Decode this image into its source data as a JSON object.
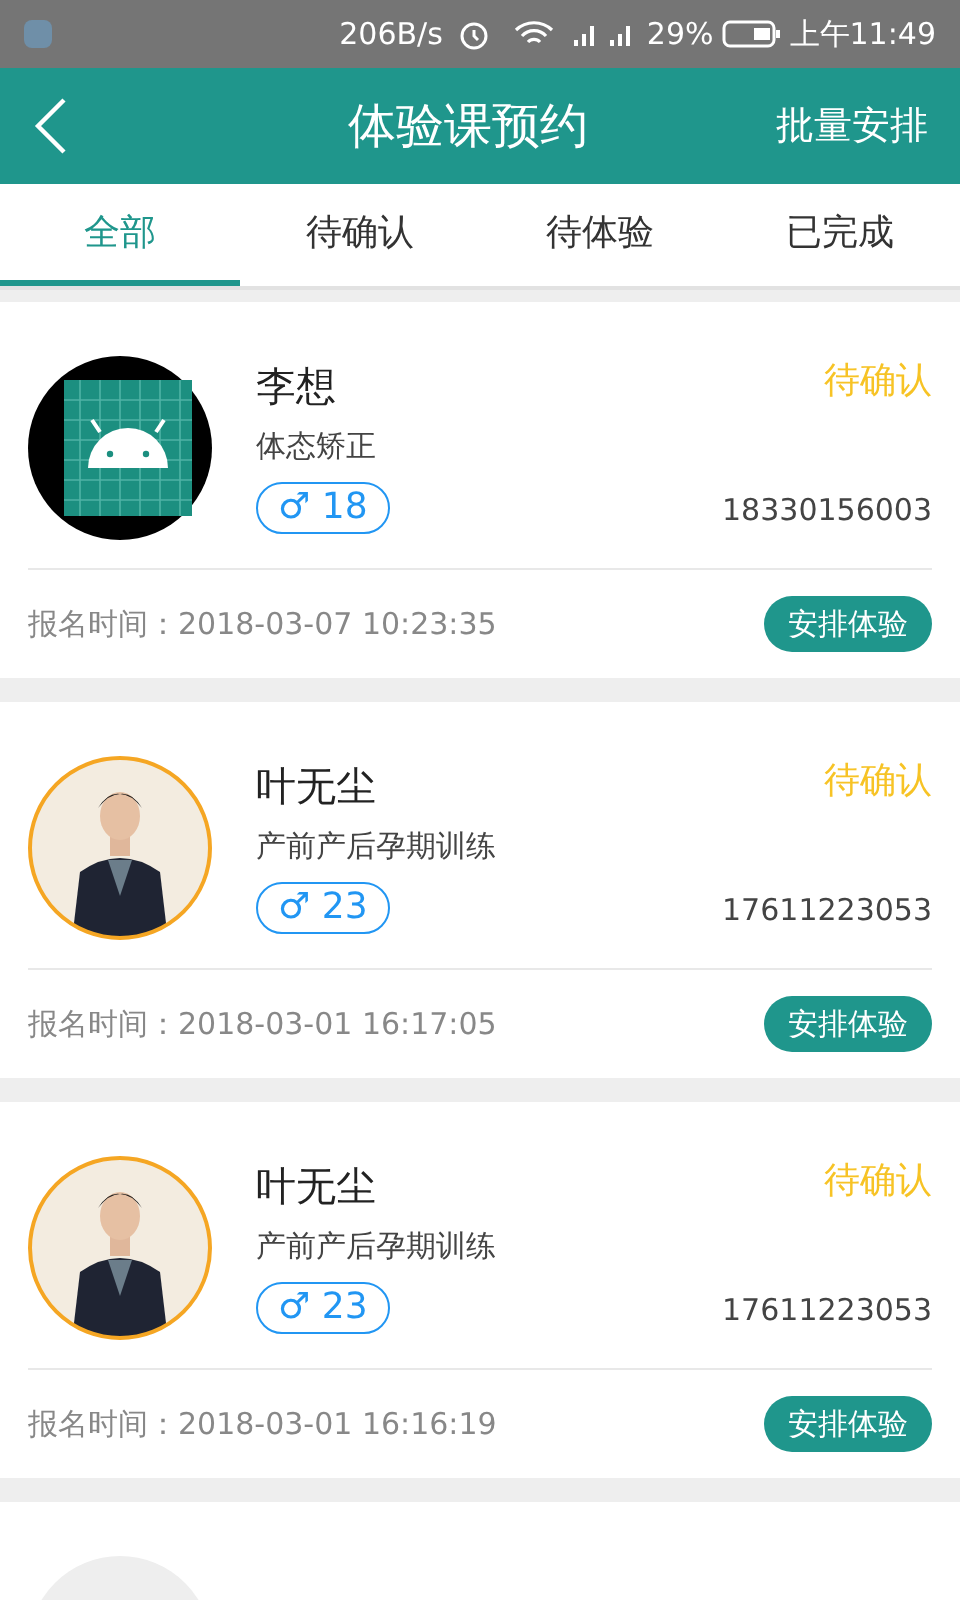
{
  "status_bar": {
    "speed": "206B/s",
    "battery": "29%",
    "time": "上午11:49"
  },
  "header": {
    "title": "体验课预约",
    "action": "批量安排"
  },
  "tabs": [
    {
      "label": "全部",
      "selected": true
    },
    {
      "label": "待确认",
      "selected": false
    },
    {
      "label": "待体验",
      "selected": false
    },
    {
      "label": "已完成",
      "selected": false
    }
  ],
  "cards": [
    {
      "kind": "android",
      "name": "李想",
      "status": "待确认",
      "course": "体态矫正",
      "gender_symbol": "♂",
      "age": "18",
      "phone": "18330156003",
      "time_label": "报名时间：",
      "time": "2018-03-07 10:23:35",
      "button": "安排体验"
    },
    {
      "kind": "picture",
      "name": "叶无尘",
      "status": "待确认",
      "course": "产前产后孕期训练",
      "gender_symbol": "♂",
      "age": "23",
      "phone": "17611223053",
      "time_label": "报名时间：",
      "time": "2018-03-01 16:17:05",
      "button": "安排体验"
    },
    {
      "kind": "picture",
      "name": "叶无尘",
      "status": "待确认",
      "course": "产前产后孕期训练",
      "gender_symbol": "♂",
      "age": "23",
      "phone": "17611223053",
      "time_label": "报名时间：",
      "time": "2018-03-01 16:16:19",
      "button": "安排体验"
    },
    {
      "kind": "blank"
    }
  ]
}
